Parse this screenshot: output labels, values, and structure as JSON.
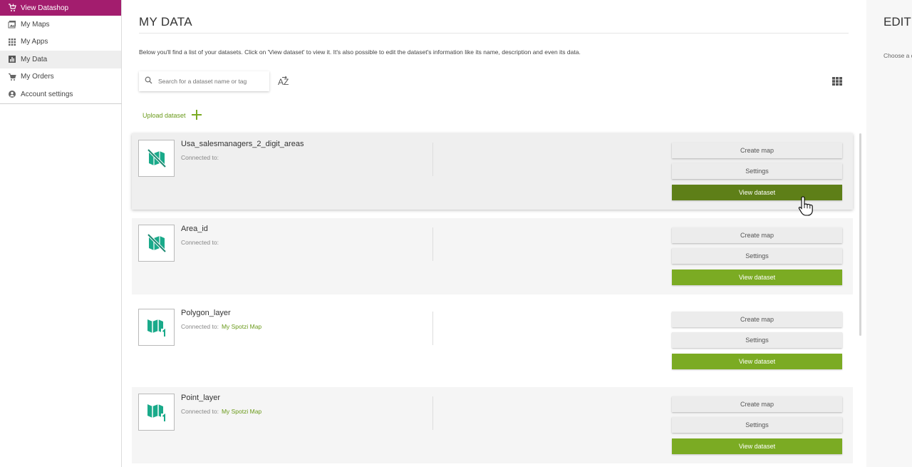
{
  "sidebar": {
    "items": [
      {
        "label": "View Datashop",
        "icon": "cart-download-icon"
      },
      {
        "label": "My Maps",
        "icon": "maps-icon"
      },
      {
        "label": "My Apps",
        "icon": "apps-grid-icon"
      },
      {
        "label": "My Data",
        "icon": "bar-chart-icon"
      },
      {
        "label": "My Orders",
        "icon": "cart-icon"
      },
      {
        "label": "Account settings",
        "icon": "account-icon"
      }
    ],
    "highlight_color": "#a31d6e"
  },
  "main": {
    "title": "MY DATA",
    "intro": "Below you'll find a list of your datasets. Click on 'View dataset' to view it. It's also possible to edit the dataset's information like its name, description and even its data.",
    "search": {
      "placeholder": "Search for a dataset name or tag"
    },
    "sort_label": "AZ",
    "upload_label": "Upload dataset",
    "accent_color": "#7bab23"
  },
  "datasets": [
    {
      "name": "Usa_salesmanagers_2_digit_areas",
      "connected_label": "Connected to:",
      "connected_map": "",
      "icon": "no-map-icon",
      "create_map": "Create map",
      "settings": "Settings",
      "view": "View dataset"
    },
    {
      "name": "Area_id",
      "connected_label": "Connected to:",
      "connected_map": "",
      "icon": "no-map-icon",
      "create_map": "Create map",
      "settings": "Settings",
      "view": "View dataset"
    },
    {
      "name": "Polygon_layer",
      "connected_label": "Connected to:",
      "connected_map": "My Spotzi Map",
      "icon": "map-icon",
      "create_map": "Create map",
      "settings": "Settings",
      "view": "View dataset"
    },
    {
      "name": "Point_layer",
      "connected_label": "Connected to:",
      "connected_map": "My Spotzi Map",
      "icon": "map-icon",
      "create_map": "Create map",
      "settings": "Settings",
      "view": "View dataset"
    }
  ],
  "right_panel": {
    "title": "EDIT DATASET",
    "hint": "Choose a dataset to edit"
  }
}
